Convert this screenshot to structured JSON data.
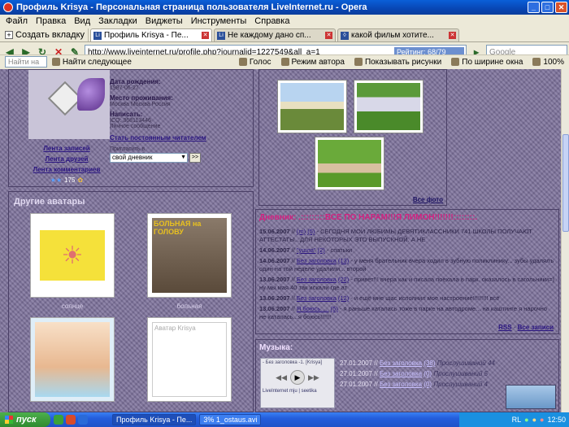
{
  "window": {
    "title": "Профиль Krisya - Персональная страница пользователя LiveInternet.ru - Opera"
  },
  "menu": [
    "Файл",
    "Правка",
    "Вид",
    "Закладки",
    "Виджеты",
    "Инструменты",
    "Справка"
  ],
  "tabs": {
    "new_tab": "Создать вкладку",
    "items": [
      {
        "label": "Профиль Krisya - Пе...",
        "fav": "Li"
      },
      {
        "label": "Не каждому дано сп...",
        "fav": "Li"
      },
      {
        "label": "какой фильм хотите...",
        "fav": "◊"
      }
    ]
  },
  "address": {
    "url": "http://www.liveinternet.ru/profile.php?journalid=1227549&all_a=1",
    "rating": "Рейтинг: 68/79",
    "search_placeholder": "Google"
  },
  "toolbar": {
    "find_placeholder": "Найти на странице",
    "find_next": "Найти следующее",
    "voice": "Голос",
    "author_mode": "Режим автора",
    "show_images": "Показывать рисунки",
    "fit_width": "По ширине окна",
    "zoom": "100%"
  },
  "profile": {
    "birth_label": "Дата рождения:",
    "birth_value": "1987-06-27",
    "place_label": "Место проживания:",
    "place_value": "Москва Москва Россия",
    "write_label": "Написать:",
    "write_value": "ICQ: 368113446",
    "message": "Личное сообщение",
    "links": [
      "Лента записей",
      "Лента друзей",
      "Лента комментариев"
    ],
    "reader": "Стать постоянным читателем",
    "invite": "Пригласить в",
    "select": "свой дневник",
    "go": ">>",
    "stars": "175"
  },
  "gallery_link": "Все фото",
  "other_avatars": {
    "title": "Другие аватары",
    "items": [
      {
        "caption": "солнце"
      },
      {
        "caption": "больная",
        "text": "БОЛЬНАЯ на ГОЛОВУ"
      },
      {
        "caption": ""
      },
      {
        "caption": "",
        "text": "Аватар Krisya"
      }
    ]
  },
  "diary": {
    "title": "Дневник: .:::::::::ВСЕ ПО НАРАМ!!!Я ЛИМОН!!!!!!!::::::::.",
    "entries": [
      {
        "date": "15.06.2007",
        "title": "(m)",
        "count": "(5)",
        "text": "- СЕГОДНЯ МОИ ЛЮБИМЫ ДЕВЯТИКЛАССНИКИ 741 ШКОЛЫ ПОЛУЧАЮТ АТТЕСТАТЫ...ДЛЯ НЕКОТОРЫХ ЭТО ВЫПУСКНОЙ. А НЕ"
      },
      {
        "date": "14.06.2007",
        "title": "\"ушла\"",
        "count": "(2)",
        "text": "- спатьки"
      },
      {
        "date": "14.06.2007",
        "title": "Без заголовка",
        "count": "(13)",
        "text": "- у меня брательник вчера ходил в зубную поликлинику... зубы удалялъ один на той неделе удалили... второй"
      },
      {
        "date": "13.06.2007",
        "title": "Без заголовка",
        "count": "(22)",
        "text": "- привет!!! вчера как и писала поехала в парк. оказалось в сагольники=) ну мы мая 40 так искали где ат"
      },
      {
        "date": "13.06.2007",
        "title": "Без заголовка",
        "count": "(12)",
        "text": "- и ещё мне щас исполнил мое настроение!!!!!!!!! всё"
      },
      {
        "date": "13.06.2007",
        "title": "Я боюсь.....",
        "count": "(5)",
        "text": "- я раньше каталась тоже в парке на автодроме... на каштинге я нарочно не каталась...я боюсь!!!!!!"
      }
    ],
    "rss": "RSS",
    "all": "Все записи"
  },
  "music": {
    "title": "Музыка:",
    "player_label": "- Без заголовка -1. [Krisya]",
    "player_brand": "LiveInternet mju | seetika",
    "tracks": [
      {
        "date": "27.01.2007",
        "title": "Без заголовка",
        "count": "(38)",
        "listened": "Прослушиваний 44"
      },
      {
        "date": "27.01.2007",
        "title": "Без заголовка",
        "count": "(0)",
        "listened": "Прослушиваний 5"
      },
      {
        "date": "27.01.2007",
        "title": "Без заголовка",
        "count": "(0)",
        "listened": "Прослушиваний 4"
      }
    ]
  },
  "taskbar": {
    "start": "пуск",
    "tasks": [
      "Профиль Krisya - Пе...",
      "3% 1_ostaus.avi"
    ],
    "lang": "RL",
    "time": "12:50"
  }
}
